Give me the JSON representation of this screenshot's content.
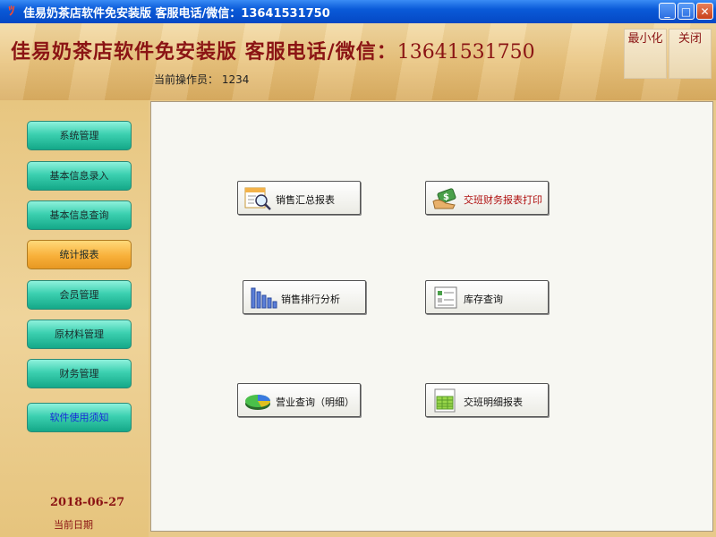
{
  "window": {
    "title": "佳易奶茶店软件免安装版  客服电话/微信：13641531750",
    "minimize_glyph": "_",
    "maximize_glyph": "□",
    "close_glyph": "✕"
  },
  "header": {
    "title": "佳易奶茶店软件免安装版  客服电话/微信：",
    "phone": "13641531750",
    "operator": "当前操作员：  1234",
    "minimize_label": "最小化",
    "close_label": "关闭"
  },
  "sidebar": {
    "items": [
      {
        "label": "系统管理"
      },
      {
        "label": "基本信息录入"
      },
      {
        "label": "基本信息查询"
      },
      {
        "label": "统计报表"
      },
      {
        "label": "会员管理"
      },
      {
        "label": "原材料管理"
      },
      {
        "label": "财务管理"
      },
      {
        "label": "软件使用须知"
      }
    ],
    "active_index": 3,
    "date": "2018-06-27",
    "date_label": "当前日期"
  },
  "reports": {
    "sales_summary": "销售汇总报表",
    "shift_finance_print": "交班财务报表打印",
    "sales_ranking": "销售排行分析",
    "inventory_query": "库存查询",
    "business_query": "营业查询（明细）",
    "shift_detail": "交班明细报表"
  },
  "colors": {
    "title_red": "#8b1414",
    "nav_teal": "#3cd0b0",
    "nav_active": "#f8b03a",
    "titlebar_blue": "#0a5ad8"
  }
}
